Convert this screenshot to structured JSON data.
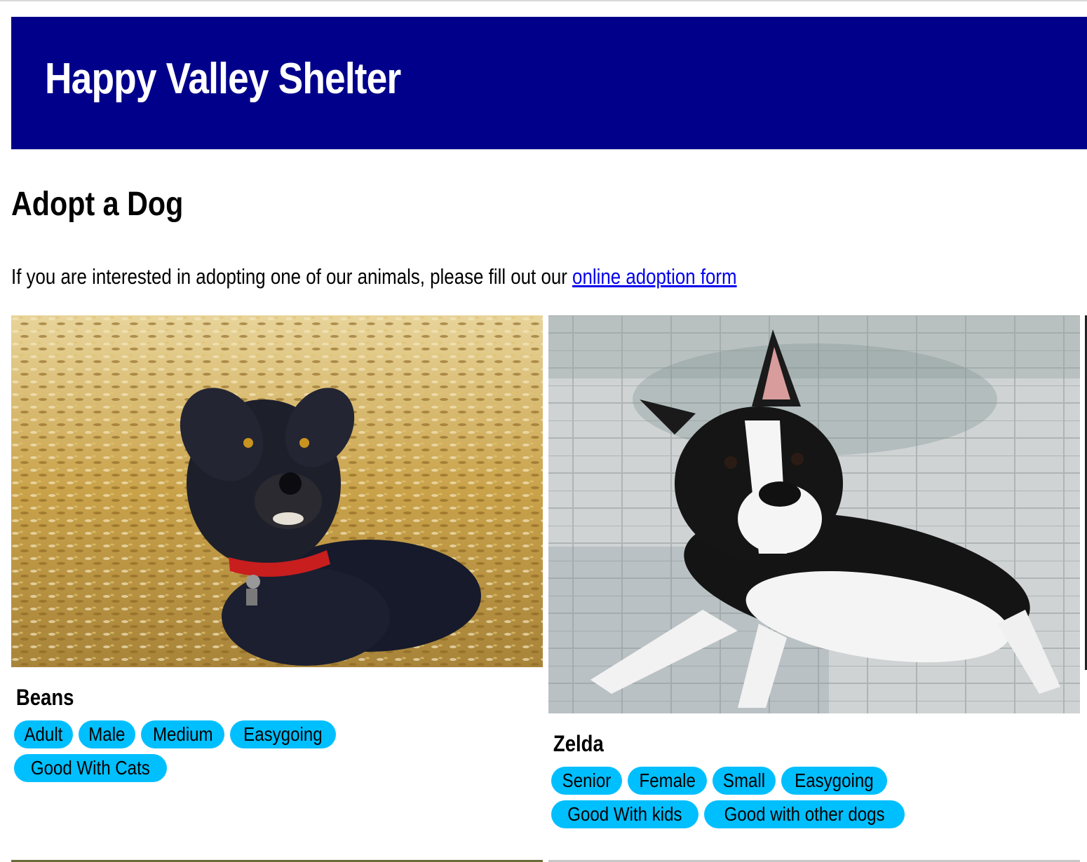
{
  "header": {
    "title": "Happy Valley Shelter",
    "background_color": "#00008b"
  },
  "main": {
    "heading": "Adopt a Dog",
    "intro_text": "If you are interested in adopting one of our animals, please fill out our ",
    "intro_link": "online adoption form",
    "link_color": "#0000ee",
    "tag_color": "#00bfff"
  },
  "pets": [
    {
      "name": "Beans",
      "photo": "black-scruffy-dog-photo",
      "tags": [
        "Adult",
        "Male",
        "Medium",
        "Easygoing",
        "Good With Cats"
      ]
    },
    {
      "name": "Zelda",
      "photo": "boston-terrier-photo",
      "tags": [
        "Senior",
        "Female",
        "Small",
        "Easygoing",
        "Good With kids",
        "Good with other dogs"
      ]
    }
  ]
}
